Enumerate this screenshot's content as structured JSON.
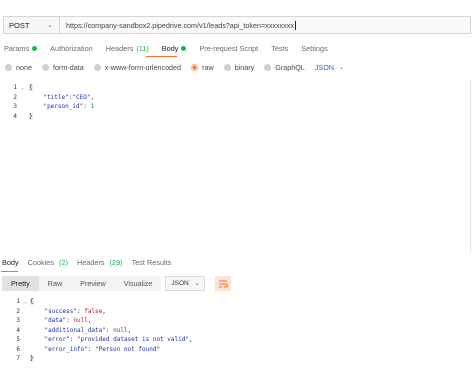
{
  "request": {
    "method": "POST",
    "url": "https://company-sandbox2.pipedrive.com/v1/leads?api_token=xxxxxxxx",
    "tabs": [
      {
        "label": "Params",
        "indicator": "dot"
      },
      {
        "label": "Authorization"
      },
      {
        "label": "Headers",
        "count": "(11)"
      },
      {
        "label": "Body",
        "indicator": "dot",
        "active": true
      },
      {
        "label": "Pre-request Script"
      },
      {
        "label": "Tests"
      },
      {
        "label": "Settings"
      }
    ],
    "body_types": [
      "none",
      "form-data",
      "x-www-form-urlencoded",
      "raw",
      "binary",
      "GraphQL"
    ],
    "body_selected": "raw",
    "body_format": "JSON",
    "line_numbers": [
      "1",
      "2",
      "3",
      "4"
    ],
    "code_lines": [
      {
        "parts": [
          {
            "t": "{",
            "c": "brace"
          }
        ]
      },
      {
        "parts": [
          {
            "t": "    ",
            "c": ""
          },
          {
            "t": "\"title\"",
            "c": "str"
          },
          {
            "t": ":",
            "c": ""
          },
          {
            "t": "\"CEO\"",
            "c": "str"
          },
          {
            "t": ",",
            "c": ""
          }
        ]
      },
      {
        "parts": [
          {
            "t": "    ",
            "c": ""
          },
          {
            "t": "\"person_id\"",
            "c": "str"
          },
          {
            "t": ": ",
            "c": ""
          },
          {
            "t": "1",
            "c": "num"
          }
        ]
      },
      {
        "parts": [
          {
            "t": "}",
            "c": "brace"
          }
        ]
      }
    ]
  },
  "response": {
    "tabs": [
      {
        "label": "Body",
        "active": true
      },
      {
        "label": "Cookies",
        "count": "(2)"
      },
      {
        "label": "Headers",
        "count": "(29)"
      },
      {
        "label": "Test Results"
      }
    ],
    "view_modes": [
      "Pretty",
      "Raw",
      "Preview",
      "Visualize"
    ],
    "view_active": "Pretty",
    "format": "JSON",
    "line_numbers": [
      "1",
      "2",
      "3",
      "4",
      "5",
      "6",
      "7"
    ],
    "code_lines": [
      {
        "parts": [
          {
            "t": "{",
            "c": "brace"
          }
        ]
      },
      {
        "parts": [
          {
            "t": "    ",
            "c": ""
          },
          {
            "t": "\"success\"",
            "c": "str"
          },
          {
            "t": ": ",
            "c": ""
          },
          {
            "t": "false",
            "c": "kw"
          },
          {
            "t": ",",
            "c": ""
          }
        ]
      },
      {
        "parts": [
          {
            "t": "    ",
            "c": ""
          },
          {
            "t": "\"data\"",
            "c": "str"
          },
          {
            "t": ": ",
            "c": ""
          },
          {
            "t": "null",
            "c": "kw"
          },
          {
            "t": ",",
            "c": ""
          }
        ]
      },
      {
        "parts": [
          {
            "t": "    ",
            "c": ""
          },
          {
            "t": "\"additional_data\"",
            "c": "str"
          },
          {
            "t": ": ",
            "c": ""
          },
          {
            "t": "null",
            "c": "kw"
          },
          {
            "t": ",",
            "c": ""
          }
        ]
      },
      {
        "parts": [
          {
            "t": "    ",
            "c": ""
          },
          {
            "t": "\"error\"",
            "c": "str"
          },
          {
            "t": ": ",
            "c": ""
          },
          {
            "t": "\"provided dataset is not valid\"",
            "c": "str"
          },
          {
            "t": ",",
            "c": ""
          }
        ]
      },
      {
        "parts": [
          {
            "t": "    ",
            "c": ""
          },
          {
            "t": "\"error_info\"",
            "c": "str"
          },
          {
            "t": ": ",
            "c": ""
          },
          {
            "t": "\"Person not found\"",
            "c": "str"
          }
        ]
      },
      {
        "parts": [
          {
            "t": "}",
            "c": "brace"
          }
        ]
      }
    ]
  },
  "colors": {
    "accent": "#ff6c37",
    "indicator_green": "#0cbb52",
    "json_blue": "#1a6cd6",
    "string": "#1a2fa8",
    "number": "#06894a",
    "keyword": "#b31a2e"
  },
  "icons": {
    "method_dropdown": "chevron-down-icon",
    "format_dropdown": "chevron-down-icon",
    "wrap": "wrap-lines-icon"
  }
}
